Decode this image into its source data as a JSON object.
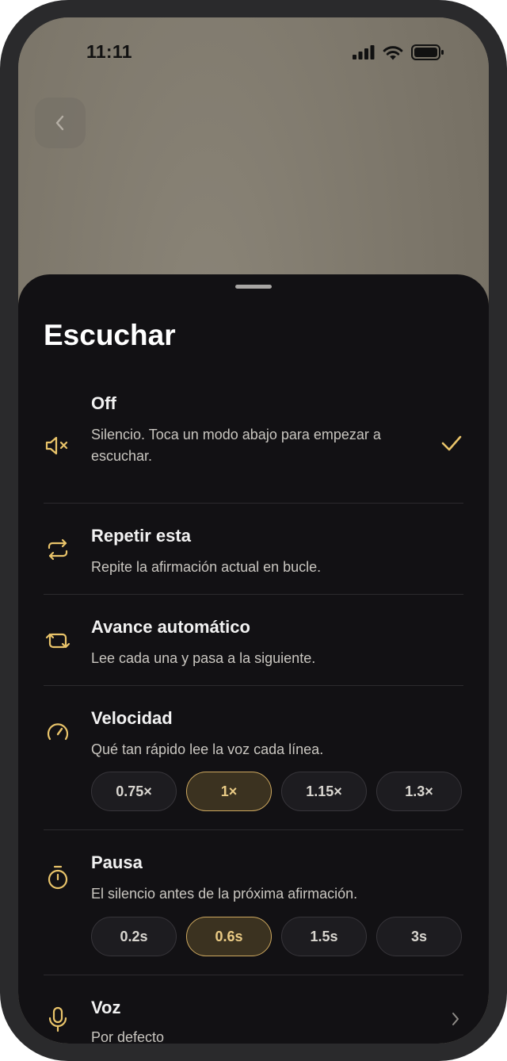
{
  "status_bar": {
    "time": "11:11"
  },
  "sheet": {
    "title": "Escuchar",
    "options": [
      {
        "title": "Off",
        "description": "Silencio. Toca un modo abajo para empezar a escuchar.",
        "icon": "speaker-muted-icon",
        "selected": true
      },
      {
        "title": "Repetir esta",
        "description": "Repite la afirmación actual en bucle.",
        "icon": "repeat-icon",
        "selected": false
      },
      {
        "title": "Avance automático",
        "description": "Lee cada una y pasa a la siguiente.",
        "icon": "auto-advance-icon",
        "selected": false
      }
    ],
    "speed": {
      "title": "Velocidad",
      "description": "Qué tan rápido lee la voz cada línea.",
      "icon": "speedometer-icon",
      "options": [
        "0.75×",
        "1×",
        "1.15×",
        "1.3×"
      ],
      "selected": "1×"
    },
    "pause": {
      "title": "Pausa",
      "description": "El silencio antes de la próxima afirmación.",
      "icon": "timer-icon",
      "options": [
        "0.2s",
        "0.6s",
        "1.5s",
        "3s"
      ],
      "selected": "0.6s"
    },
    "voice": {
      "title": "Voz",
      "value": "Por defecto",
      "icon": "microphone-icon"
    }
  },
  "colors": {
    "accent": "#E9C46A",
    "sheet_bg": "#121114",
    "selected_chip_bg": "#3B3220"
  }
}
